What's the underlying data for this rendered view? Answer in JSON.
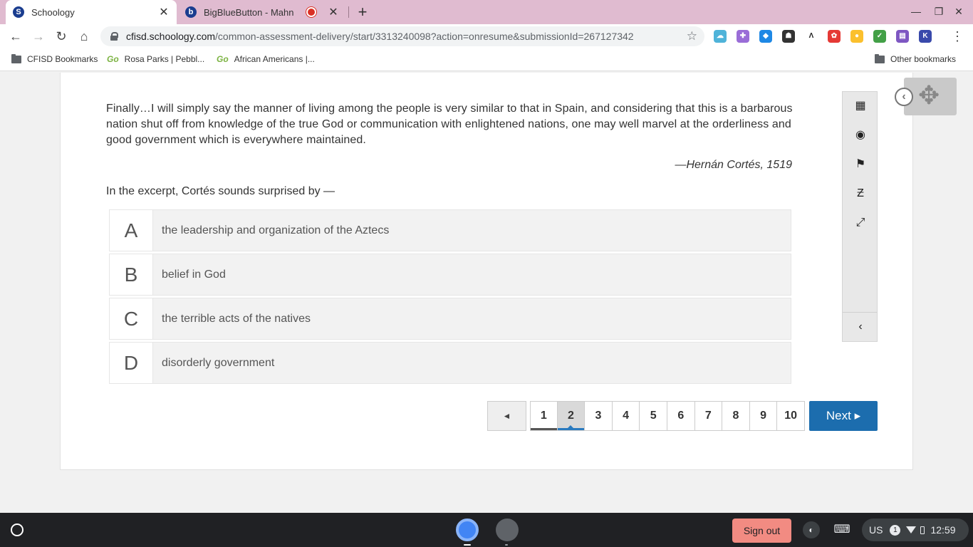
{
  "browser": {
    "tabs": [
      {
        "title": "Schoology",
        "favicon": "S"
      },
      {
        "title": "BigBlueButton - Mahn",
        "favicon": "b"
      }
    ],
    "url_domain": "cfisd.schoology.com",
    "url_path": "/common-assessment-delivery/start/3313240098?action=onresume&submissionId=267127342",
    "bookmarks": [
      {
        "label": "CFISD Bookmarks",
        "icon": "folder-icon"
      },
      {
        "label": "Rosa Parks | Pebbl...",
        "icon": "go-icon"
      },
      {
        "label": "African Americans |...",
        "icon": "go-icon"
      }
    ],
    "go_prefix": "Go",
    "other_bookmarks": "Other bookmarks"
  },
  "assessment": {
    "passage": "Finally…I will simply say the manner of living among the people is very similar to that in Spain, and considering that this is a barbarous nation shut off from knowledge of the true God or communication with enlightened nations, one may well marvel at the orderliness and good government which is everywhere maintained.",
    "attribution": "—Hernán Cortés, 1519",
    "question": "In the excerpt, Cortés sounds surprised by —",
    "choices": [
      {
        "letter": "A",
        "text": "the leadership and organization of the Aztecs"
      },
      {
        "letter": "B",
        "text": "belief in God"
      },
      {
        "letter": "C",
        "text": "the terrible acts of the natives"
      },
      {
        "letter": "D",
        "text": "disorderly government"
      }
    ],
    "pages": [
      "1",
      "2",
      "3",
      "4",
      "5",
      "6",
      "7",
      "8",
      "9",
      "10"
    ],
    "current_page": "2",
    "prev_label": "◄",
    "next_label": "Next ▸"
  },
  "shelf": {
    "sign_out": "Sign out",
    "locale": "US",
    "notification_count": "1",
    "time": "12:59"
  },
  "colors": {
    "accent": "#1c6dae",
    "tabstrip": "#e0bbd0",
    "sign_out": "#f28b82"
  }
}
